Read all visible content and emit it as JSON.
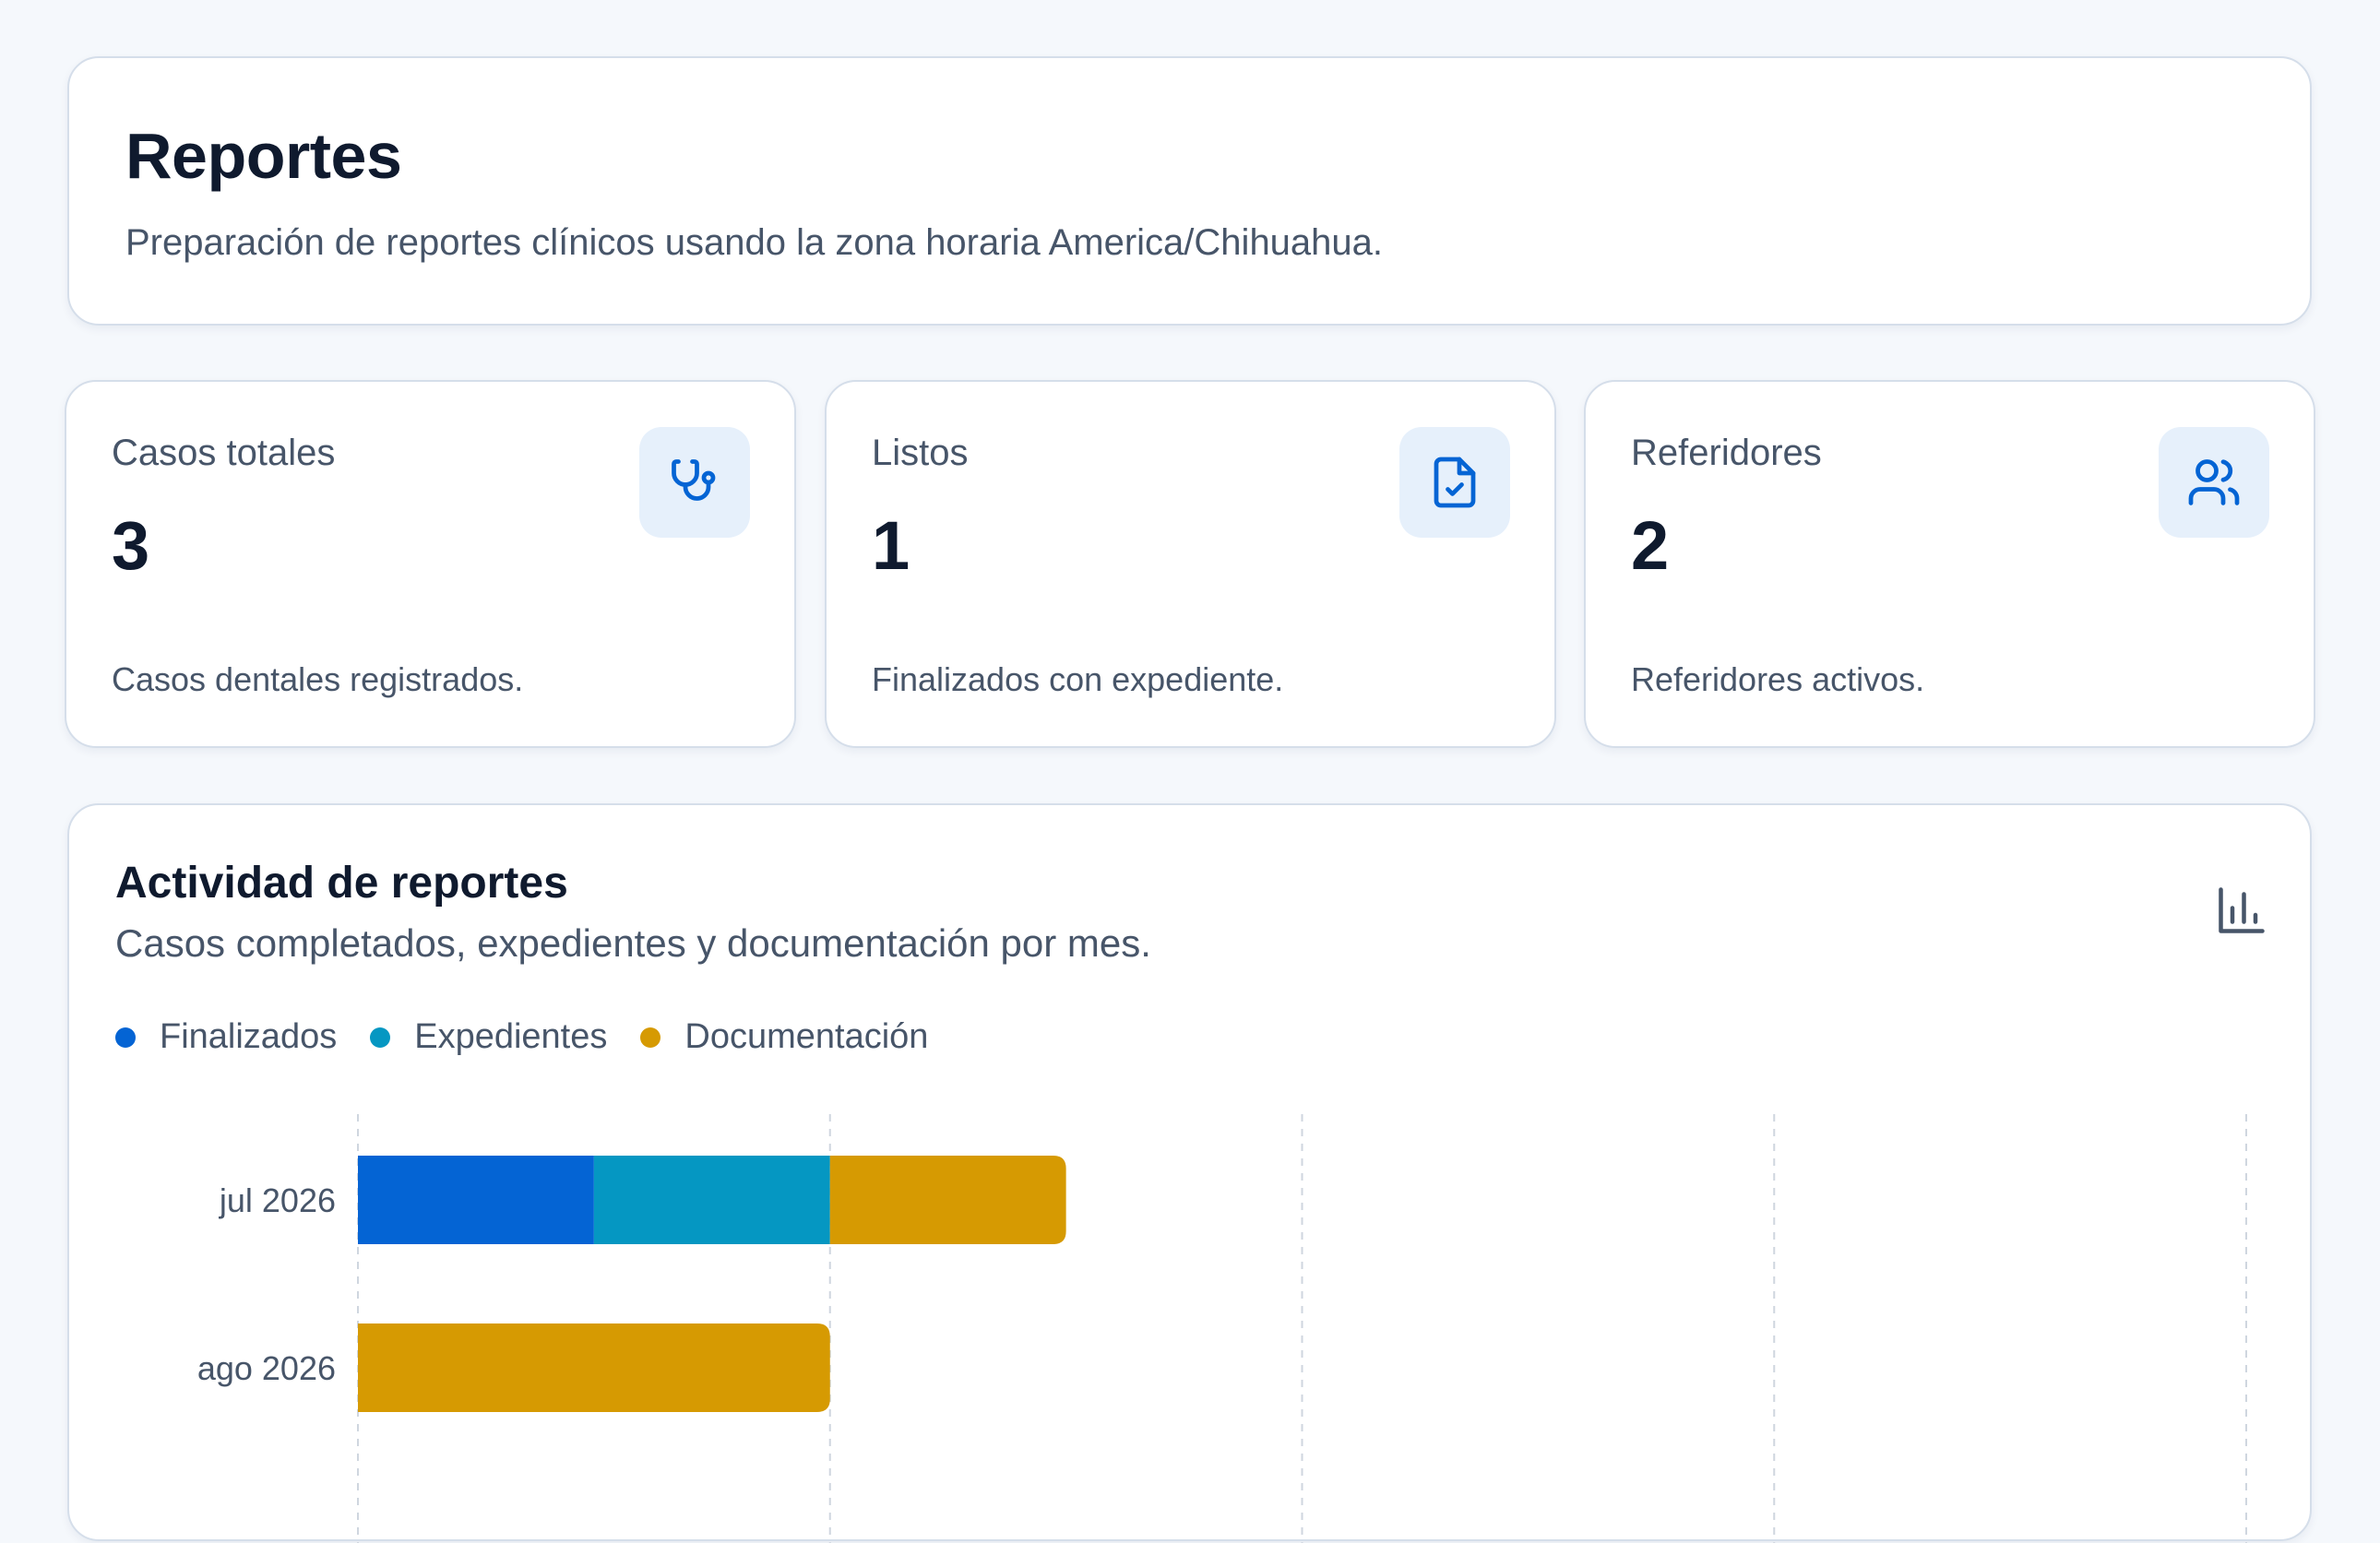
{
  "header": {
    "title": "Reportes",
    "subtitle": "Preparación de reportes clínicos usando la zona horaria America/Chihuahua."
  },
  "stats": [
    {
      "label": "Casos totales",
      "value": "3",
      "description": "Casos dentales registrados.",
      "icon": "stethoscope-icon"
    },
    {
      "label": "Listos",
      "value": "1",
      "description": "Finalizados con expediente.",
      "icon": "file-check-icon"
    },
    {
      "label": "Referidores",
      "value": "2",
      "description": "Referidores activos.",
      "icon": "users-icon"
    }
  ],
  "chart": {
    "title": "Actividad de reportes",
    "subtitle": "Casos completados, expedientes y documentación por mes.",
    "icon": "bar-chart-icon",
    "legend": [
      {
        "label": "Finalizados",
        "color": "#0464d4"
      },
      {
        "label": "Expedientes",
        "color": "#0597c2"
      },
      {
        "label": "Documentación",
        "color": "#d69a02"
      }
    ]
  },
  "chart_data": {
    "type": "bar",
    "orientation": "horizontal",
    "stacked": true,
    "categories": [
      "jul 2026",
      "ago 2026"
    ],
    "series": [
      {
        "name": "Finalizados",
        "values": [
          1,
          0
        ],
        "color": "#0464d4"
      },
      {
        "name": "Expedientes",
        "values": [
          1,
          0
        ],
        "color": "#0597c2"
      },
      {
        "name": "Documentación",
        "values": [
          1,
          2
        ],
        "color": "#d69a02"
      }
    ],
    "xlim": [
      0,
      8
    ],
    "grid": true,
    "legend_position": "top-left"
  },
  "colors": {
    "accent": "#0464d4",
    "icon_bg": "#e6f0fb",
    "text_primary": "#0f1a2e",
    "text_secondary": "#475569"
  }
}
